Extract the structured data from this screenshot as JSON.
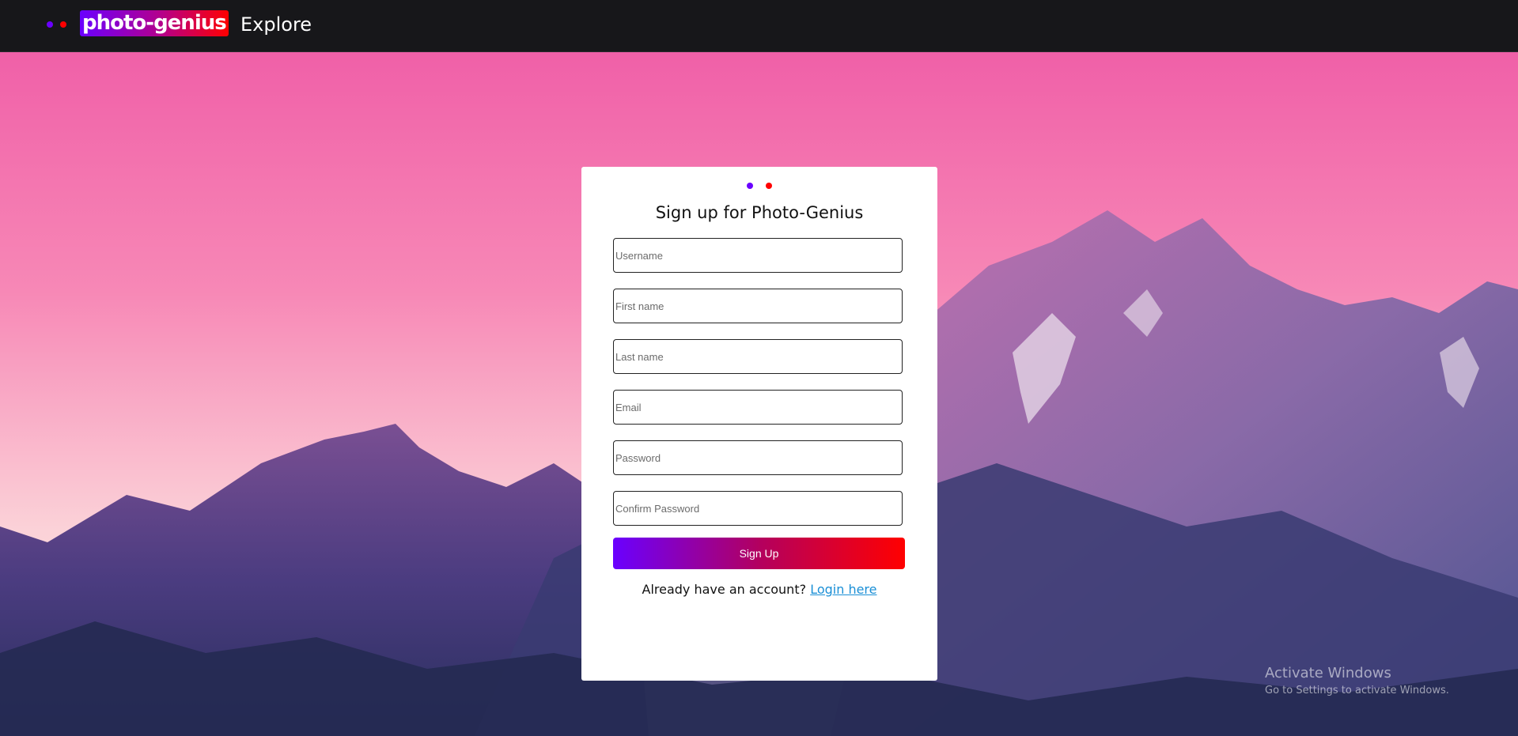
{
  "navbar": {
    "brand": "photo-genius",
    "explore": "Explore"
  },
  "signup": {
    "title": "Sign up for Photo-Genius",
    "fields": {
      "username": "Username",
      "first_name": "First name",
      "last_name": "Last name",
      "email": "Email",
      "password": "Password",
      "confirm_password": "Confirm Password"
    },
    "button": "Sign Up",
    "have_account": "Already have an account?",
    "login_link": "Login here"
  },
  "watermark": {
    "title": "Activate Windows",
    "subtitle": "Go to Settings to activate Windows."
  },
  "colors": {
    "accent_purple": "#6a00ff",
    "accent_red": "#ff0000",
    "link": "#1a8fd6",
    "navbar_bg": "#17171a"
  }
}
